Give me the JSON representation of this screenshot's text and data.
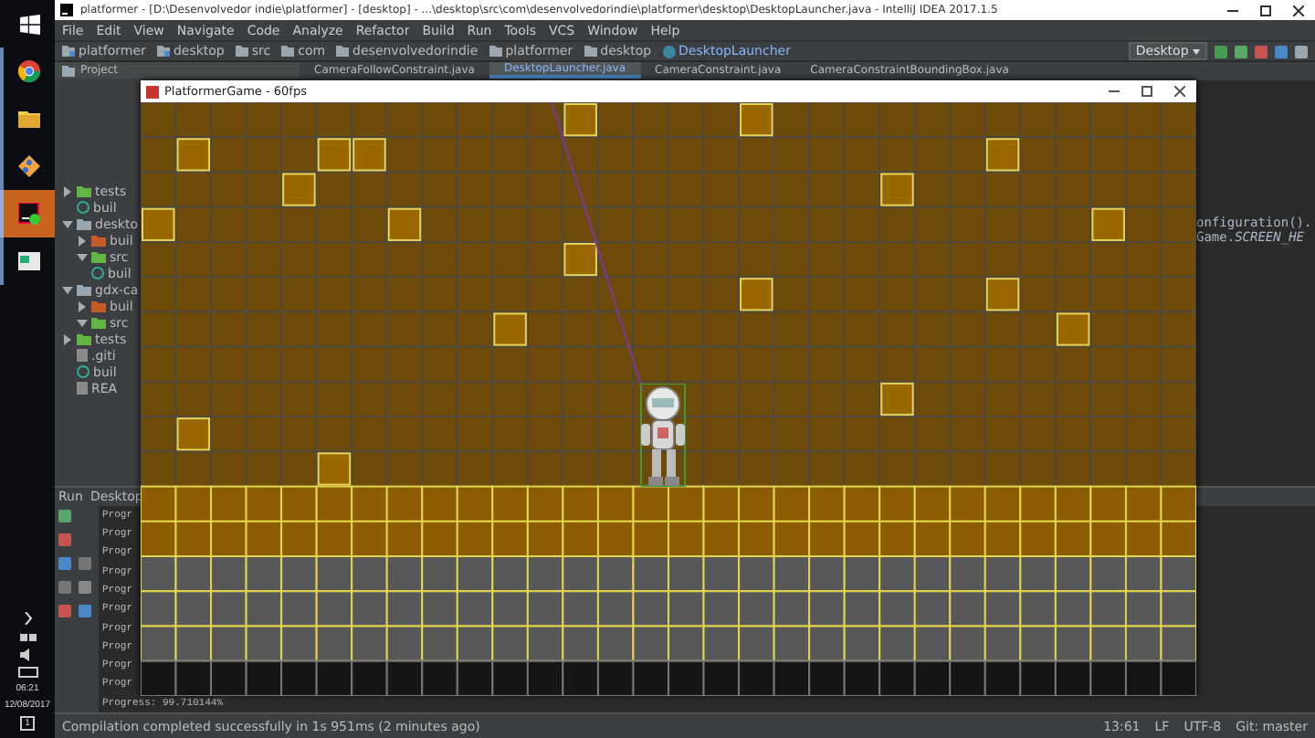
{
  "taskbar": {
    "apps": [
      {
        "kind": "start",
        "selected": false
      },
      {
        "kind": "browser",
        "selected": false
      },
      {
        "kind": "folder",
        "selected": false
      },
      {
        "kind": "git",
        "selected": false
      },
      {
        "kind": "ide",
        "selected": true
      },
      {
        "kind": "window",
        "selected": false
      }
    ],
    "time": "06:21",
    "date": "12/08/2017",
    "notifications": "1"
  },
  "ide": {
    "title": "platformer - [D:\\Desenvolvedor indie\\platformer] - [desktop] - ...\\desktop\\src\\com\\desenvolvedorindie\\platformer\\desktop\\DesktopLauncher.java - IntelliJ IDEA 2017.1.5",
    "menu": [
      "File",
      "Edit",
      "View",
      "Navigate",
      "Code",
      "Analyze",
      "Refactor",
      "Build",
      "Run",
      "Tools",
      "VCS",
      "Window",
      "Help"
    ],
    "breadcrumbs": [
      {
        "label": "platformer",
        "kind": "module"
      },
      {
        "label": "desktop",
        "kind": "module"
      },
      {
        "label": "src",
        "kind": "folder"
      },
      {
        "label": "com",
        "kind": "folder"
      },
      {
        "label": "desenvolvedorindie",
        "kind": "folder"
      },
      {
        "label": "platformer",
        "kind": "folder"
      },
      {
        "label": "desktop",
        "kind": "folder"
      },
      {
        "label": "DesktopLauncher",
        "kind": "class"
      }
    ],
    "run_config": "Desktop",
    "project_label": "Project",
    "tabs": [
      {
        "label": "CameraFollowConstraint.java",
        "selected": false
      },
      {
        "label": "DesktopLauncher.java",
        "selected": true
      },
      {
        "label": "CameraConstraint.java",
        "selected": false
      },
      {
        "label": "CameraConstraintBoundingBox.java",
        "selected": false
      }
    ],
    "tree": [
      {
        "label": "tests",
        "kind": "folder",
        "expanded": false
      },
      {
        "label": "buil",
        "kind": "gradle"
      },
      {
        "label": "deskto",
        "kind": "module",
        "expanded": true,
        "children": [
          {
            "label": "buil",
            "kind": "build",
            "expanded": false
          },
          {
            "label": "src",
            "kind": "folder",
            "expanded": true
          },
          {
            "label": "buil",
            "kind": "gradle"
          }
        ]
      },
      {
        "label": "gdx-ca",
        "kind": "module",
        "expanded": true,
        "children": [
          {
            "label": "buil",
            "kind": "build",
            "expanded": false
          },
          {
            "label": "src",
            "kind": "folder",
            "expanded": true
          }
        ]
      },
      {
        "label": "tests",
        "kind": "folder",
        "expanded": false
      },
      {
        "label": ".giti",
        "kind": "file"
      },
      {
        "label": "buil",
        "kind": "gradle"
      },
      {
        "label": "REA",
        "kind": "file"
      }
    ],
    "code_lines": [
      "onfiguration().",
      "Game.*SCREEN_HE*"
    ],
    "run_panel": {
      "title": "Run",
      "tab": "Desktop",
      "console": [
        "Progr",
        "Progr",
        "Progr",
        "Progr",
        "Progr",
        "Progr",
        "Progr",
        "Progr",
        "Progr",
        "Progr",
        "Progress: 99.710144%"
      ]
    },
    "status_bar": {
      "message": "Compilation completed successfully in 1s 951ms (2 minutes ago)",
      "position": "13:61",
      "line_separator": "LF",
      "encoding": "UTF-8",
      "vcs": "Git: master"
    }
  },
  "game_window": {
    "title": "PlatformerGame - 60fps"
  }
}
